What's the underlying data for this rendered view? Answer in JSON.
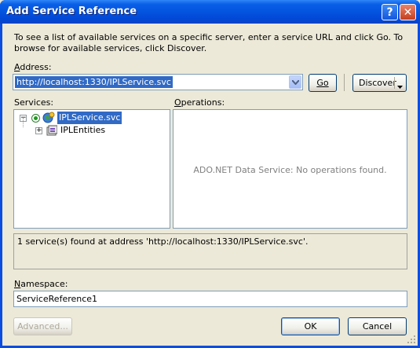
{
  "window": {
    "title": "Add Service Reference",
    "help_glyph": "?",
    "close_glyph": "✕"
  },
  "intro_text": "To see a list of available services on a specific server, enter a service URL and click Go. To browse for available services, click Discover.",
  "address": {
    "label": "Address:",
    "value": "http://localhost:1330/IPLService.svc",
    "go_label": "Go",
    "discover_label": "Discover"
  },
  "services": {
    "label": "Services:",
    "tree": [
      {
        "label": "IPLService.svc",
        "icon": "service-globe-icon",
        "expanded": true,
        "selected": true
      },
      {
        "label": "IPLEntities",
        "icon": "class-icon",
        "expanded": false,
        "selected": false
      }
    ]
  },
  "operations": {
    "label": "Operations:",
    "empty_message": "ADO.NET Data Service: No operations found."
  },
  "status_message": "1 service(s) found at address 'http://localhost:1330/IPLService.svc'.",
  "namespace": {
    "label": "Namespace:",
    "value": "ServiceReference1"
  },
  "buttons": {
    "advanced": "Advanced...",
    "ok": "OK",
    "cancel": "Cancel"
  }
}
